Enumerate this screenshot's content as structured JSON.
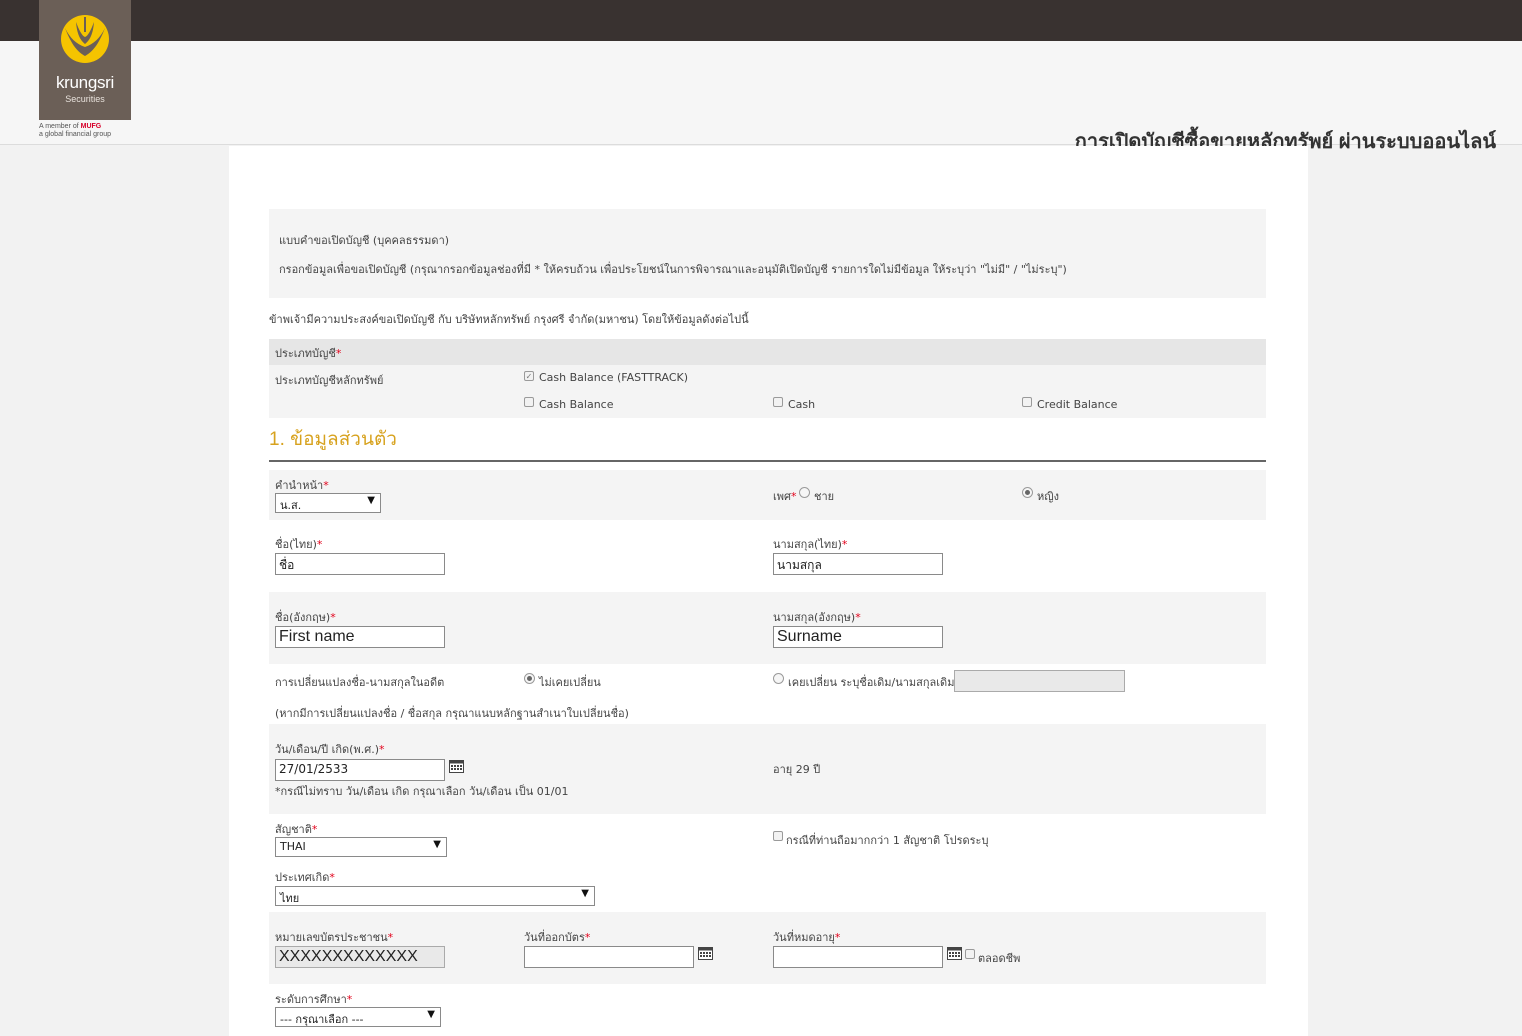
{
  "brand": {
    "name": "krungsri",
    "sub": "Securities",
    "member_text": "A member of",
    "mufg": "MUFG",
    "tagline": "a global financial group"
  },
  "header": {
    "title": "การเปิดบัญชีซื้อขายหลักทรัพย์ ผ่านระบบออนไลน์"
  },
  "intro": {
    "form_title": "แบบคำขอเปิดบัญชี (บุคคลธรรมดา)",
    "instruction": "กรอกข้อมูลเพื่อขอเปิดบัญชี (กรุณากรอกข้อมูลช่องที่มี * ให้ครบถ้วน เพื่อประโยชน์ในการพิจารณาและอนุมัติเปิดบัญชี รายการใดไม่มีข้อมูล ให้ระบุว่า \"ไม่มี\" / \"ไม่ระบุ\")",
    "declaration": "ข้าพเจ้ามีความประสงค์ขอเปิดบัญชี กับ บริษัทหลักทรัพย์ กรุงศรี จำกัด(มหาชน) โดยให้ข้อมูลดังต่อไปนี้"
  },
  "account_type": {
    "heading": "ประเภทบัญชี",
    "label": "ประเภทบัญชีหลักทรัพย์",
    "options": [
      "Cash Balance (FASTTRACK)",
      "Cash Balance",
      "Cash",
      "Credit Balance"
    ]
  },
  "section1": {
    "title": "1. ข้อมูลส่วนตัว"
  },
  "title_field": {
    "label": "คำนำหน้า",
    "value": "น.ส."
  },
  "gender": {
    "label": "เพศ",
    "male": "ชาย",
    "female": "หญิง"
  },
  "name_th": {
    "label": "ชื่อ(ไทย)",
    "value": "ชื่อ"
  },
  "surname_th": {
    "label": "นามสกุล(ไทย)",
    "value": "นามสกุล"
  },
  "name_en": {
    "label": "ชื่อ(อังกฤษ)",
    "value": "First name"
  },
  "surname_en": {
    "label": "นามสกุล(อังกฤษ)",
    "value": "Surname"
  },
  "name_change": {
    "label": "การเปลี่ยนแปลงชื่อ-นามสกุลในอดีต",
    "never": "ไม่เคยเปลี่ยน",
    "changed": "เคยเปลี่ยน ระบุชื่อเดิม/นามสกุลเดิม",
    "note": "(หากมีการเปลี่ยนแปลงชื่อ / ชื่อสกุล กรุณาแนบหลักฐานสำเนาใบเปลี่ยนชื่อ)"
  },
  "birthdate": {
    "label": "วัน/เดือน/ปี เกิด(พ.ศ.)",
    "value": "27/01/2533",
    "note": "*กรณีไม่ทราบ วัน/เดือน เกิด กรุณาเลือก วัน/เดือน เป็น 01/01",
    "age": "อายุ 29 ปี"
  },
  "nationality": {
    "label": "สัญชาติ",
    "value": "THAI",
    "multi": "กรณีที่ท่านถือมากกว่า 1 สัญชาติ โปรดระบุ"
  },
  "birth_country": {
    "label": "ประเทศเกิด",
    "value": "ไทย"
  },
  "id_card": {
    "label": "หมายเลขบัตรประชาชน",
    "value": "XXXXXXXXXXXXX",
    "issue_label": "วันที่ออกบัตร",
    "expire_label": "วันที่หมดอายุ",
    "lifetime": "ตลอดชีพ"
  },
  "education": {
    "label": "ระดับการศึกษา",
    "value": "--- กรุณาเลือก ---"
  },
  "colors": {
    "accent": "#d7a21e",
    "required": "#e2001a",
    "topbar": "#393230",
    "logo_bg": "#6b5f57"
  }
}
